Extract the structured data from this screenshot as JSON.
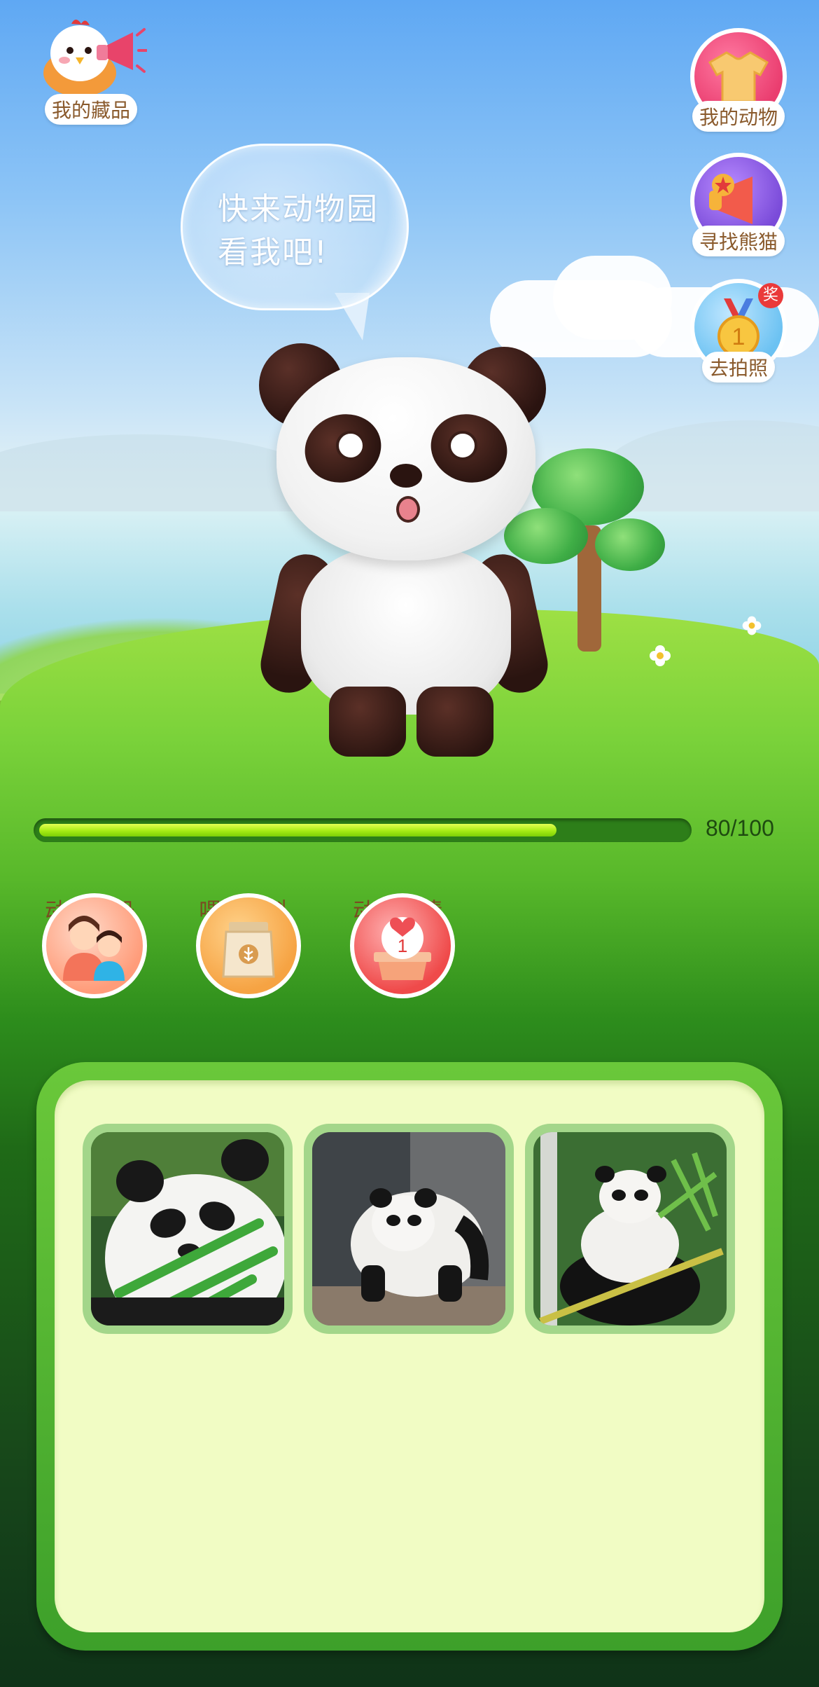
{
  "top_left": {
    "collection_label": "我的藏品",
    "icon": "chick-megaphone-icon"
  },
  "top_right": [
    {
      "label": "我的动物",
      "icon": "tshirt-icon"
    },
    {
      "label": "寻找熊猫",
      "icon": "megaphone-icon"
    },
    {
      "label": "去拍照",
      "icon": "medal-icon",
      "badge": "奖",
      "medal_number": "1"
    }
  ],
  "speech_bubble": {
    "text": "快来动物园\n看我吧!"
  },
  "progress": {
    "current": 80,
    "max": 100,
    "text": "80/100"
  },
  "features": [
    {
      "label": "动物相册",
      "icon": "family-album-icon"
    },
    {
      "label": "喂养饲料",
      "icon": "feed-bag-icon"
    },
    {
      "label": "动物表情",
      "icon": "heart-box-icon",
      "count": "1"
    }
  ],
  "gallery": {
    "photos": [
      "panda-eating-bamboo",
      "panda-walking",
      "panda-in-bamboo"
    ]
  },
  "colors": {
    "progress_fill": "#a6ec15",
    "panel_background": "#f1fcc4",
    "panel_border": "#4fb42e",
    "label_text": "#8a5a2c"
  }
}
